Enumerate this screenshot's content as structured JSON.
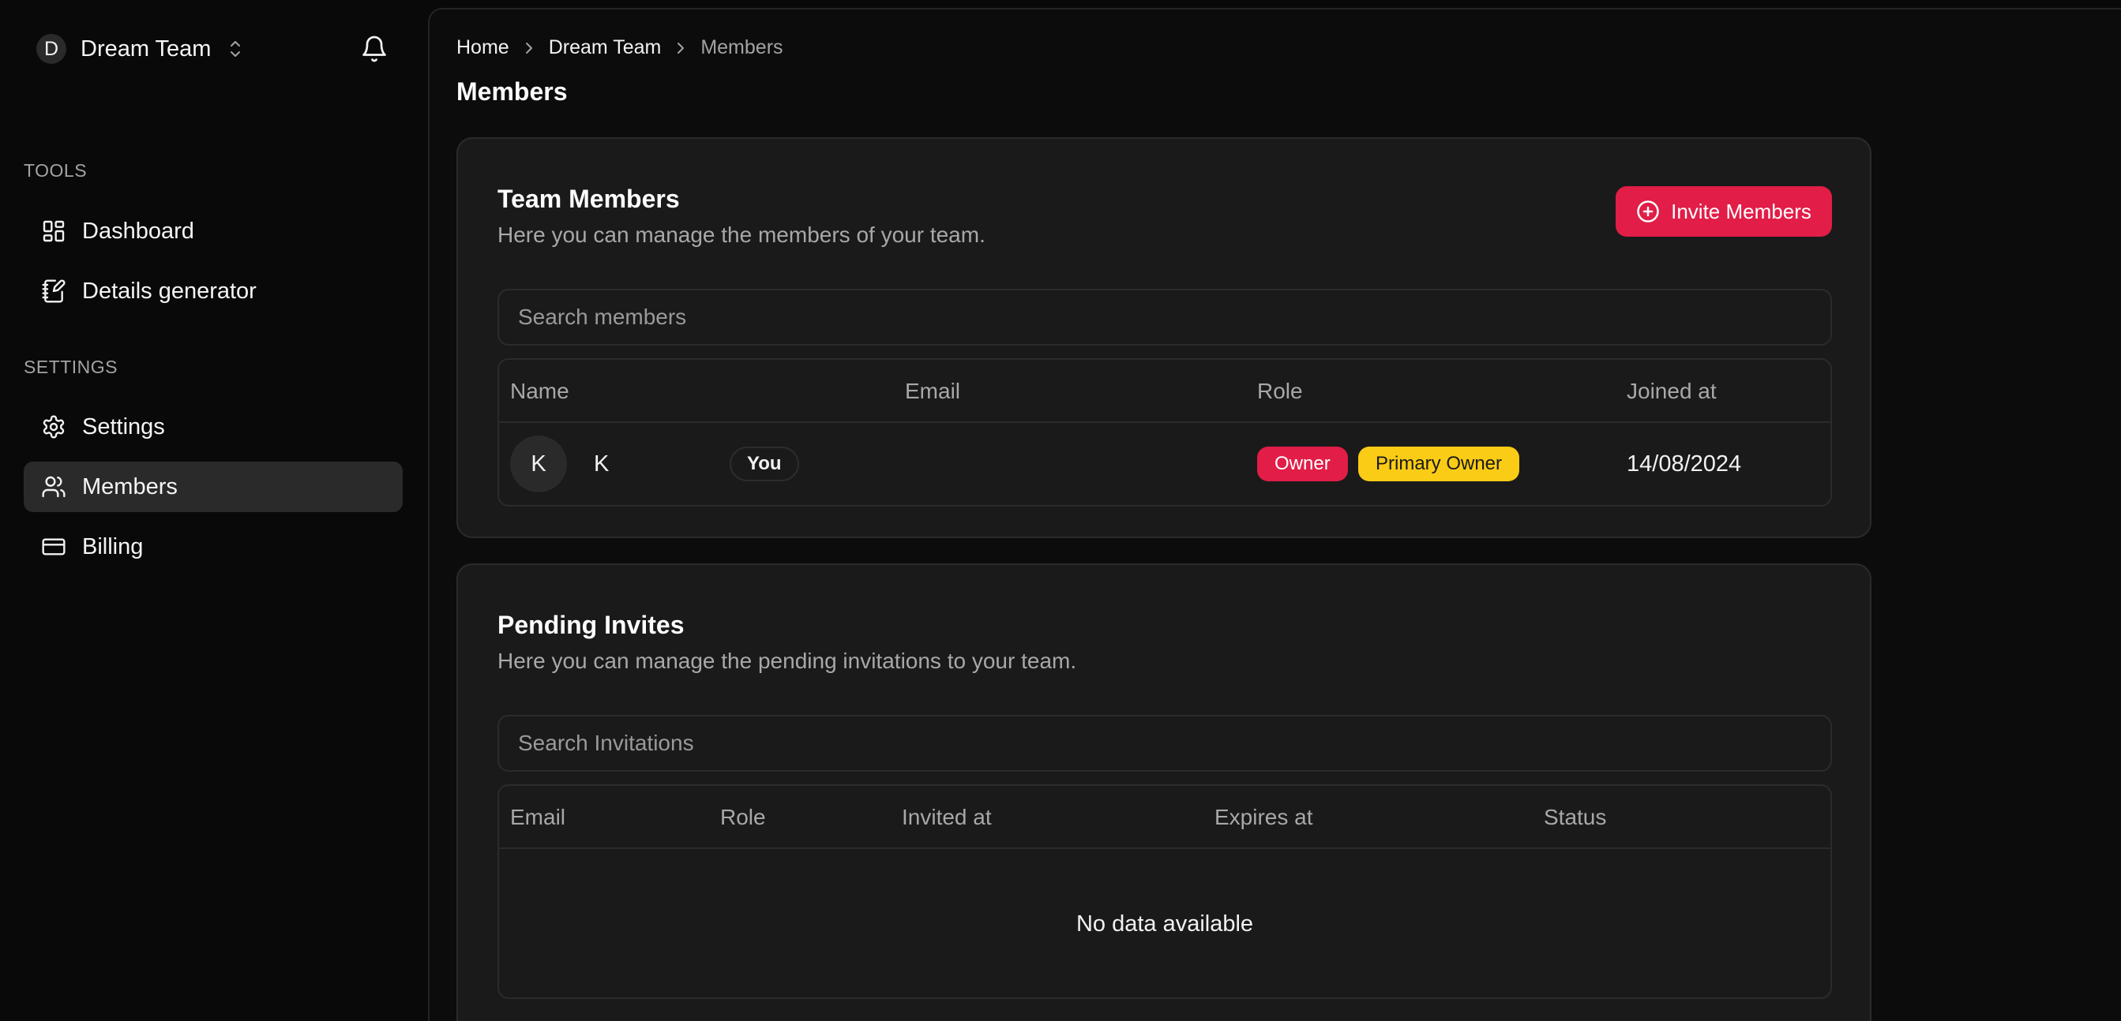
{
  "sidebar": {
    "team_initial": "D",
    "team_name": "Dream Team",
    "sections": [
      {
        "label": "TOOLS",
        "items": [
          {
            "label": "Dashboard",
            "icon": "dashboard-icon"
          },
          {
            "label": "Details generator",
            "icon": "notebook-pen-icon"
          }
        ]
      },
      {
        "label": "SETTINGS",
        "items": [
          {
            "label": "Settings",
            "icon": "gear-icon"
          },
          {
            "label": "Members",
            "icon": "users-icon",
            "active": true
          },
          {
            "label": "Billing",
            "icon": "credit-card-icon"
          }
        ]
      }
    ]
  },
  "breadcrumb": [
    "Home",
    "Dream Team",
    "Members"
  ],
  "page_title": "Members",
  "team_members": {
    "title": "Team Members",
    "description": "Here you can manage the members of your team.",
    "invite_label": "Invite Members",
    "search_placeholder": "Search members",
    "columns": [
      "Name",
      "Email",
      "Role",
      "Joined at"
    ],
    "rows": [
      {
        "avatar_initial": "K",
        "name": "K",
        "badge": "You",
        "email": "",
        "roles": [
          "Owner",
          "Primary Owner"
        ],
        "joined_at": "14/08/2024"
      }
    ]
  },
  "pending_invites": {
    "title": "Pending Invites",
    "description": "Here you can manage the pending invitations to your team.",
    "search_placeholder": "Search Invitations",
    "columns": [
      "Email",
      "Role",
      "Invited at",
      "Expires at",
      "Status"
    ],
    "empty_text": "No data available"
  },
  "colors": {
    "accent": "#e11d48",
    "primary_owner_badge": "#facc15",
    "background": "#0a0909",
    "card": "#1b1a1a"
  }
}
